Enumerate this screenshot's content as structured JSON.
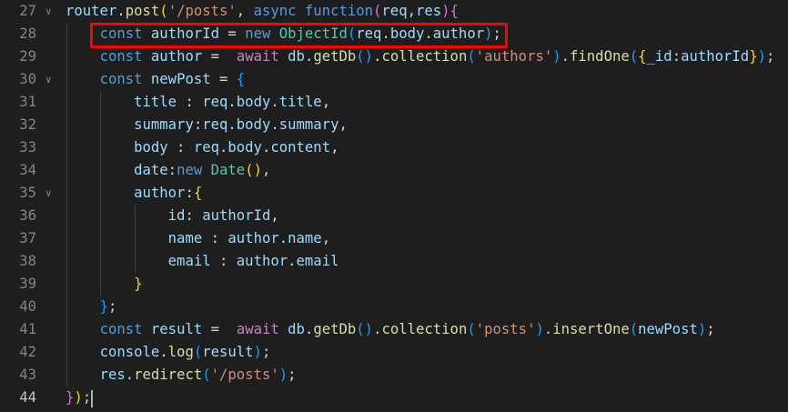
{
  "editor": {
    "active_line": 44,
    "highlighted_line": 28,
    "lines": [
      {
        "n": "27",
        "fold": true,
        "tokens": [
          [
            "router",
            "var"
          ],
          [
            ".",
            "txt"
          ],
          [
            "post",
            "fn"
          ],
          [
            "(",
            "b1"
          ],
          [
            "'/posts'",
            "str"
          ],
          [
            ", ",
            "txt"
          ],
          [
            "async",
            "kw"
          ],
          [
            " ",
            "txt"
          ],
          [
            "function",
            "kw"
          ],
          [
            "(",
            "b2"
          ],
          [
            "req",
            "var"
          ],
          [
            ",",
            "txt"
          ],
          [
            "res",
            "var"
          ],
          [
            ")",
            "b2"
          ],
          [
            "{",
            "b2"
          ]
        ]
      },
      {
        "n": "28",
        "tokens": [
          [
            "    ",
            "txt"
          ],
          [
            "const",
            "kw"
          ],
          [
            " ",
            "txt"
          ],
          [
            "authorId",
            "var"
          ],
          [
            " = ",
            "txt"
          ],
          [
            "new",
            "kw"
          ],
          [
            " ",
            "txt"
          ],
          [
            "ObjectId",
            "cls"
          ],
          [
            "(",
            "b3"
          ],
          [
            "req",
            "var"
          ],
          [
            ".",
            "txt"
          ],
          [
            "body",
            "var"
          ],
          [
            ".",
            "txt"
          ],
          [
            "author",
            "var"
          ],
          [
            ")",
            "b3"
          ],
          [
            ";",
            "txt"
          ]
        ]
      },
      {
        "n": "29",
        "tokens": [
          [
            "    ",
            "txt"
          ],
          [
            "const",
            "kw"
          ],
          [
            " ",
            "txt"
          ],
          [
            "author",
            "var"
          ],
          [
            " =  ",
            "txt"
          ],
          [
            "await",
            "ctl"
          ],
          [
            " ",
            "txt"
          ],
          [
            "db",
            "var"
          ],
          [
            ".",
            "txt"
          ],
          [
            "getDb",
            "fn"
          ],
          [
            "()",
            "b3"
          ],
          [
            ".",
            "txt"
          ],
          [
            "collection",
            "fn"
          ],
          [
            "(",
            "b3"
          ],
          [
            "'authors'",
            "str"
          ],
          [
            ")",
            "b3"
          ],
          [
            ".",
            "txt"
          ],
          [
            "findOne",
            "fn"
          ],
          [
            "(",
            "b3"
          ],
          [
            "{",
            "b1"
          ],
          [
            "_id",
            "var"
          ],
          [
            ":",
            "txt"
          ],
          [
            "authorId",
            "var"
          ],
          [
            "}",
            "b1"
          ],
          [
            ")",
            "b3"
          ],
          [
            ";",
            "txt"
          ]
        ]
      },
      {
        "n": "30",
        "fold": true,
        "tokens": [
          [
            "    ",
            "txt"
          ],
          [
            "const",
            "kw"
          ],
          [
            " ",
            "txt"
          ],
          [
            "newPost",
            "var"
          ],
          [
            " = ",
            "txt"
          ],
          [
            "{",
            "b3"
          ]
        ]
      },
      {
        "n": "31",
        "tokens": [
          [
            "        ",
            "txt"
          ],
          [
            "title",
            "var"
          ],
          [
            " : ",
            "txt"
          ],
          [
            "req",
            "var"
          ],
          [
            ".",
            "txt"
          ],
          [
            "body",
            "var"
          ],
          [
            ".",
            "txt"
          ],
          [
            "title",
            "var"
          ],
          [
            ",",
            "txt"
          ]
        ]
      },
      {
        "n": "32",
        "tokens": [
          [
            "        ",
            "txt"
          ],
          [
            "summary",
            "var"
          ],
          [
            ":",
            "txt"
          ],
          [
            "req",
            "var"
          ],
          [
            ".",
            "txt"
          ],
          [
            "body",
            "var"
          ],
          [
            ".",
            "txt"
          ],
          [
            "summary",
            "var"
          ],
          [
            ",",
            "txt"
          ]
        ]
      },
      {
        "n": "33",
        "tokens": [
          [
            "        ",
            "txt"
          ],
          [
            "body",
            "var"
          ],
          [
            " : ",
            "txt"
          ],
          [
            "req",
            "var"
          ],
          [
            ".",
            "txt"
          ],
          [
            "body",
            "var"
          ],
          [
            ".",
            "txt"
          ],
          [
            "content",
            "var"
          ],
          [
            ",",
            "txt"
          ]
        ]
      },
      {
        "n": "34",
        "tokens": [
          [
            "        ",
            "txt"
          ],
          [
            "date",
            "var"
          ],
          [
            ":",
            "txt"
          ],
          [
            "new",
            "kw"
          ],
          [
            " ",
            "txt"
          ],
          [
            "Date",
            "cls"
          ],
          [
            "()",
            "b1"
          ],
          [
            ",",
            "txt"
          ]
        ]
      },
      {
        "n": "35",
        "fold": true,
        "tokens": [
          [
            "        ",
            "txt"
          ],
          [
            "author",
            "var"
          ],
          [
            ":",
            "txt"
          ],
          [
            "{",
            "b1"
          ]
        ]
      },
      {
        "n": "36",
        "tokens": [
          [
            "            ",
            "txt"
          ],
          [
            "id",
            "var"
          ],
          [
            ": ",
            "txt"
          ],
          [
            "authorId",
            "var"
          ],
          [
            ",",
            "txt"
          ]
        ]
      },
      {
        "n": "37",
        "tokens": [
          [
            "            ",
            "txt"
          ],
          [
            "name",
            "var"
          ],
          [
            " : ",
            "txt"
          ],
          [
            "author",
            "var"
          ],
          [
            ".",
            "txt"
          ],
          [
            "name",
            "var"
          ],
          [
            ",",
            "txt"
          ]
        ]
      },
      {
        "n": "38",
        "tokens": [
          [
            "            ",
            "txt"
          ],
          [
            "email",
            "var"
          ],
          [
            " : ",
            "txt"
          ],
          [
            "author",
            "var"
          ],
          [
            ".",
            "txt"
          ],
          [
            "email",
            "var"
          ]
        ]
      },
      {
        "n": "39",
        "tokens": [
          [
            "        ",
            "txt"
          ],
          [
            "}",
            "b1"
          ]
        ]
      },
      {
        "n": "40",
        "tokens": [
          [
            "    ",
            "txt"
          ],
          [
            "}",
            "b3"
          ],
          [
            ";",
            "txt"
          ]
        ]
      },
      {
        "n": "41",
        "tokens": [
          [
            "    ",
            "txt"
          ],
          [
            "const",
            "kw"
          ],
          [
            " ",
            "txt"
          ],
          [
            "result",
            "var"
          ],
          [
            " =  ",
            "txt"
          ],
          [
            "await",
            "ctl"
          ],
          [
            " ",
            "txt"
          ],
          [
            "db",
            "var"
          ],
          [
            ".",
            "txt"
          ],
          [
            "getDb",
            "fn"
          ],
          [
            "()",
            "b3"
          ],
          [
            ".",
            "txt"
          ],
          [
            "collection",
            "fn"
          ],
          [
            "(",
            "b3"
          ],
          [
            "'posts'",
            "str"
          ],
          [
            ")",
            "b3"
          ],
          [
            ".",
            "txt"
          ],
          [
            "insertOne",
            "fn"
          ],
          [
            "(",
            "b3"
          ],
          [
            "newPost",
            "var"
          ],
          [
            ")",
            "b3"
          ],
          [
            ";",
            "txt"
          ]
        ]
      },
      {
        "n": "42",
        "tokens": [
          [
            "    ",
            "txt"
          ],
          [
            "console",
            "var"
          ],
          [
            ".",
            "txt"
          ],
          [
            "log",
            "fn"
          ],
          [
            "(",
            "b3"
          ],
          [
            "result",
            "var"
          ],
          [
            ")",
            "b3"
          ],
          [
            ";",
            "txt"
          ]
        ]
      },
      {
        "n": "43",
        "tokens": [
          [
            "    ",
            "txt"
          ],
          [
            "res",
            "var"
          ],
          [
            ".",
            "txt"
          ],
          [
            "redirect",
            "fn"
          ],
          [
            "(",
            "b3"
          ],
          [
            "'/posts'",
            "str"
          ],
          [
            ")",
            "b3"
          ],
          [
            ";",
            "txt"
          ]
        ]
      },
      {
        "n": "44",
        "tokens": [
          [
            "}",
            "b2"
          ],
          [
            ")",
            "b1"
          ],
          [
            ";",
            "txt"
          ]
        ]
      }
    ]
  }
}
